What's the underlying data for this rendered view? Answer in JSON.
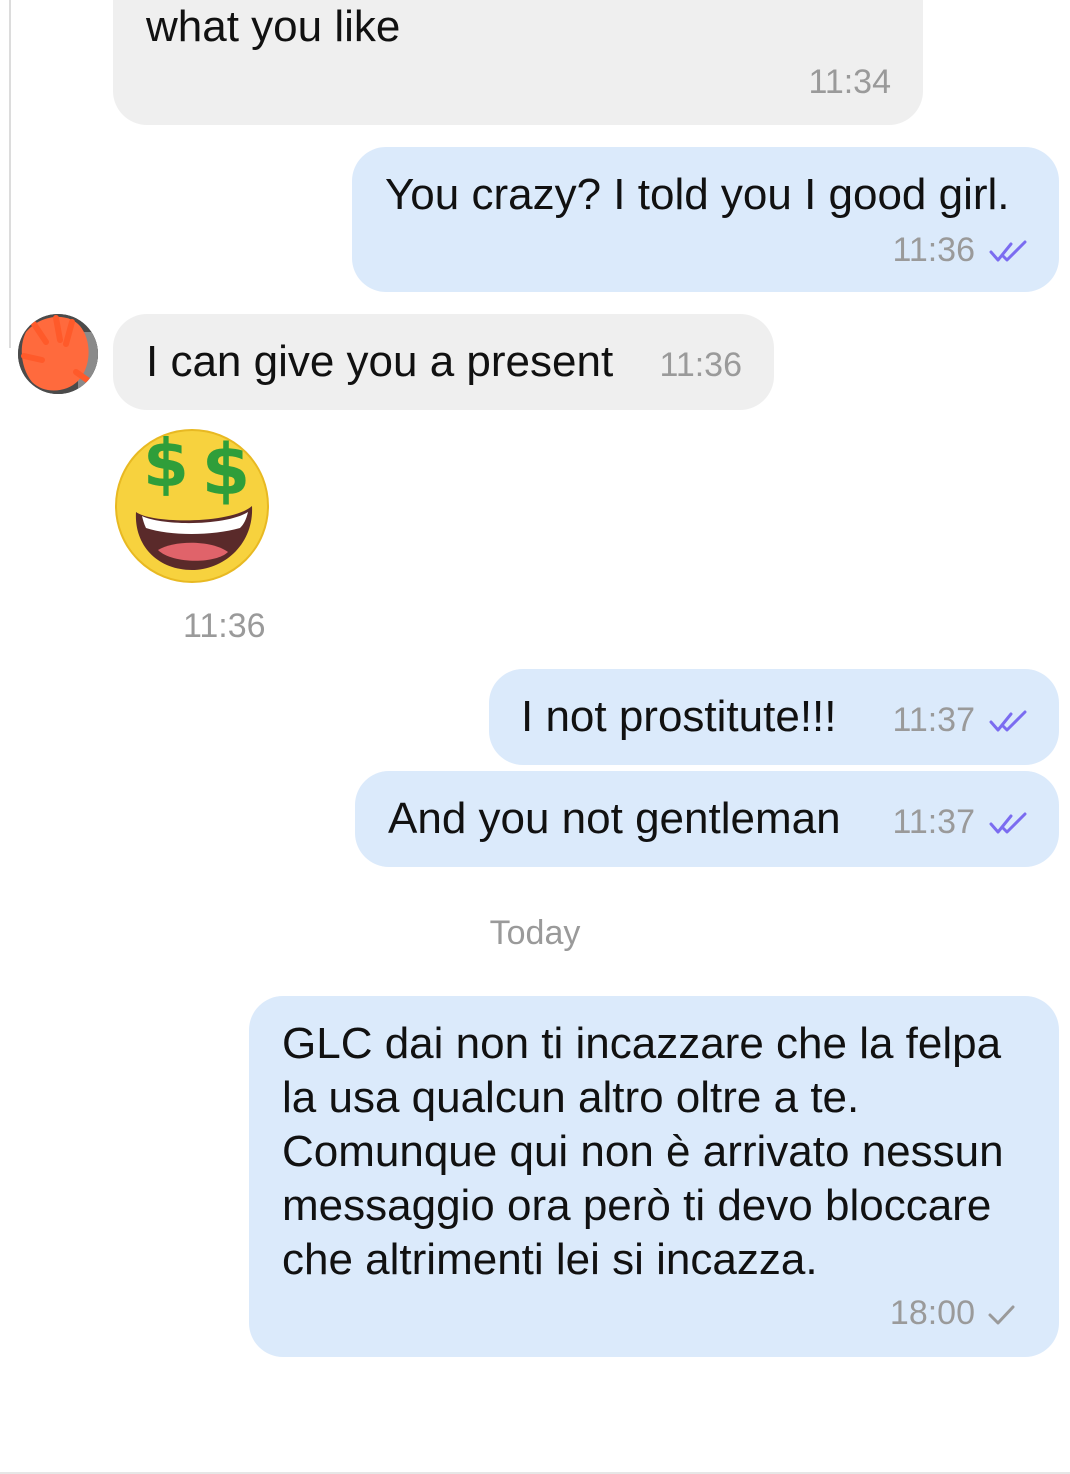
{
  "conversation": {
    "messages": [
      {
        "direction": "incoming",
        "text": "what you like",
        "time": "11:34"
      },
      {
        "direction": "outgoing",
        "text": "You crazy? I told you I good girl.",
        "time": "11:36",
        "status": "read"
      },
      {
        "direction": "incoming",
        "text": "I can give you a present",
        "time": "11:36"
      },
      {
        "direction": "incoming",
        "sticker": "money-mouth-face-icon",
        "time": "11:36"
      },
      {
        "direction": "outgoing",
        "text": "I not prostitute!!!",
        "time": "11:37",
        "status": "read"
      },
      {
        "direction": "outgoing",
        "text": "And you not gentleman",
        "time": "11:37",
        "status": "read"
      },
      {
        "direction": "outgoing",
        "text": "GLC dai non ti incazzare che la felpa la usa qualcun altro oltre a te. Comunque qui non è arrivato nessun messaggio ora però ti devo bloccare che altrimenti lei si incazza.",
        "time": "18:00",
        "status": "sent"
      }
    ],
    "date_divider": "Today"
  },
  "colors": {
    "incoming_bubble": "#efefef",
    "outgoing_bubble": "#dbeafb",
    "read_ticks": "#7b6cf0",
    "sent_tick": "#9a9a9a",
    "timestamp": "#9a9a9a",
    "avatar_scribble": "#ff6a3d"
  },
  "icons": {
    "read_status": "double-check-icon",
    "sent_status": "check-icon",
    "sticker": "money-mouth-face-icon",
    "avatar": "avatar"
  }
}
